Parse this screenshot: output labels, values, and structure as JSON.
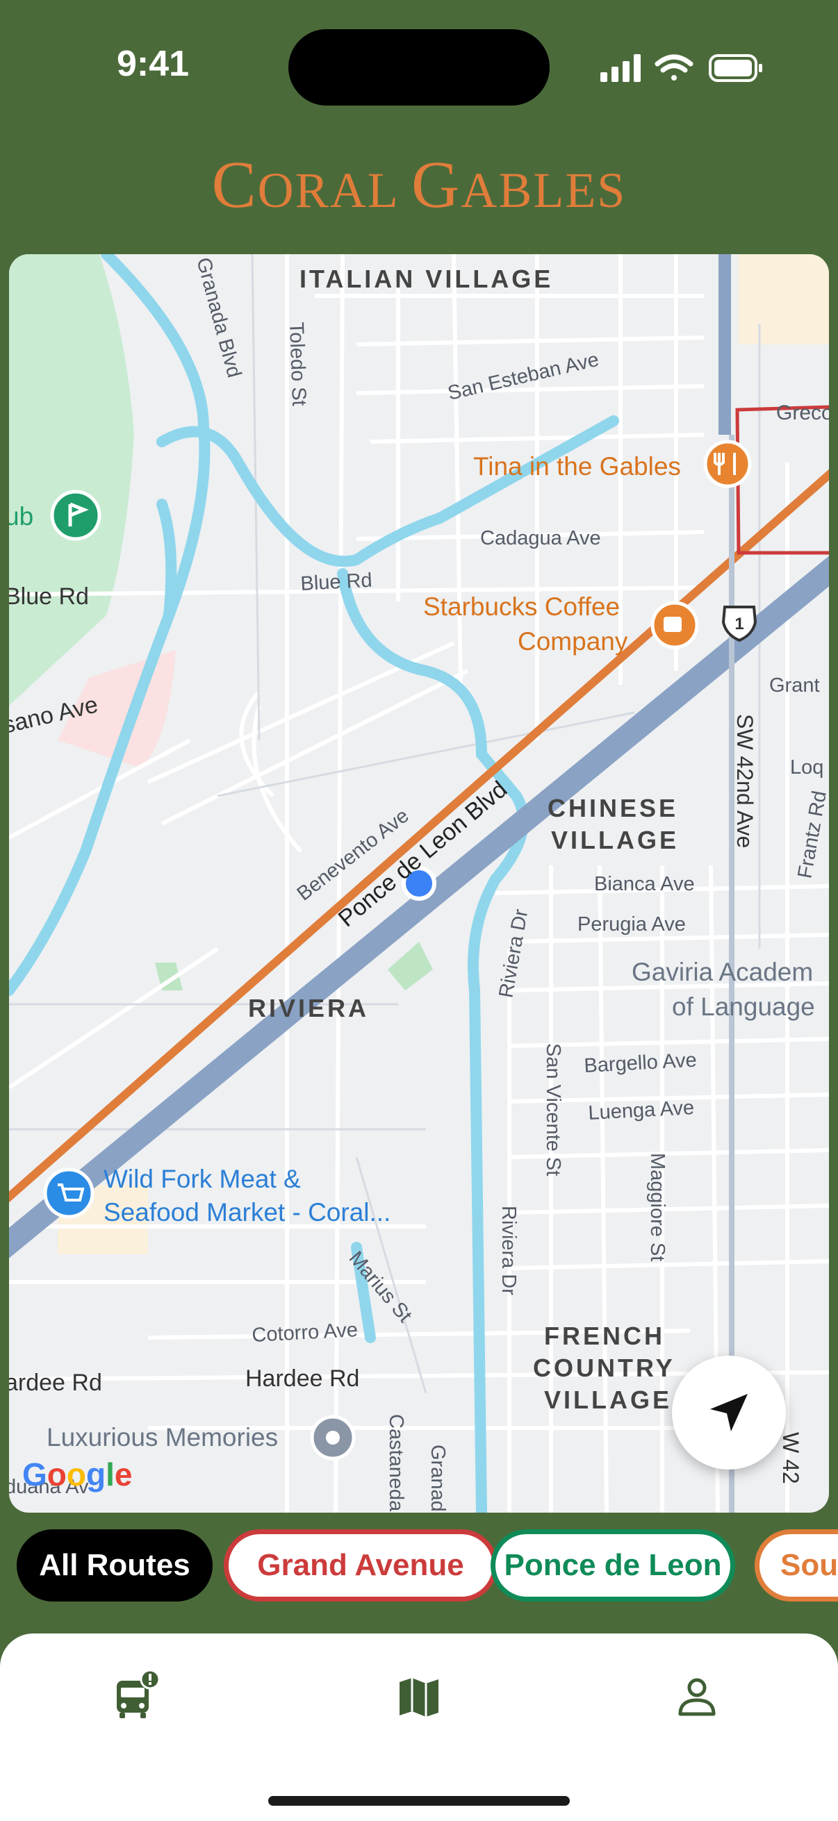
{
  "status": {
    "time": "9:41"
  },
  "app": {
    "logo_big1": "C",
    "logo_small1": "ORAL ",
    "logo_big2": "G",
    "logo_small2": "ABLES"
  },
  "map": {
    "neighborhoods": [
      "ITALIAN VILLAGE",
      "CHINESE",
      "VILLAGE",
      "RIVIERA",
      "FRENCH",
      "COUNTRY",
      "VILLAGE"
    ],
    "streets": {
      "granada": "Granada Blvd",
      "toledo": "Toledo St",
      "san_esteban": "San Esteban Ave",
      "cadagua": "Cadagua Ave",
      "blue_rd": "Blue Rd",
      "blue_rd_left": "Blue Rd",
      "sano": "sano Ave",
      "benevento": "Benevento Ave",
      "ponce": "Ponce de Leon Blvd",
      "sw42": "SW 42nd Ave",
      "grant": "Grant",
      "loq": "Loq",
      "frantz": "Frantz Rd",
      "bianca": "Bianca Ave",
      "perugia": "Perugia Ave",
      "riviera1": "Riviera Dr",
      "riviera2": "Riviera Dr",
      "san_vicente": "San Vicente St",
      "bargello": "Bargello Ave",
      "luenga": "Luenga Ave",
      "maggiore": "Maggiore St",
      "marius": "Marius St",
      "cotorro": "Cotorro Ave",
      "hardee": "Hardee Rd",
      "hardee_left": "ardee Rd",
      "castaneda": "Castaneda",
      "granada2": "Granad",
      "duana": "duana Av",
      "gre": "Greco",
      "sw42b": "W 42"
    },
    "pois": {
      "club": "ub",
      "tina": "Tina in the Gables",
      "starbucks1": "Starbucks Coffee",
      "starbucks2": "Company",
      "wildfork1": "Wild Fork Meat &",
      "wildfork2": "Seafood Market - Coral...",
      "gaviria1": "Gaviria Academ",
      "gaviria2": "of Language",
      "luxurious": "Luxurious Memories"
    },
    "highway_shield": "1",
    "attribution": "Google"
  },
  "routes": {
    "chips": [
      {
        "label": "All Routes",
        "color": "#000000"
      },
      {
        "label": "Grand Avenue",
        "color": "#cc3b3b"
      },
      {
        "label": "Ponce de Leon",
        "color": "#0f8b58"
      },
      {
        "label": "Sout",
        "color": "#e07d3a"
      }
    ]
  },
  "tabs": {
    "alerts_icon": "bus-alert-icon",
    "map_icon": "map-icon",
    "profile_icon": "profile-icon"
  },
  "colors": {
    "brand_green": "#4b6a3a",
    "accent_orange": "#e07d3a",
    "route_blue": "#8aa2c4"
  }
}
